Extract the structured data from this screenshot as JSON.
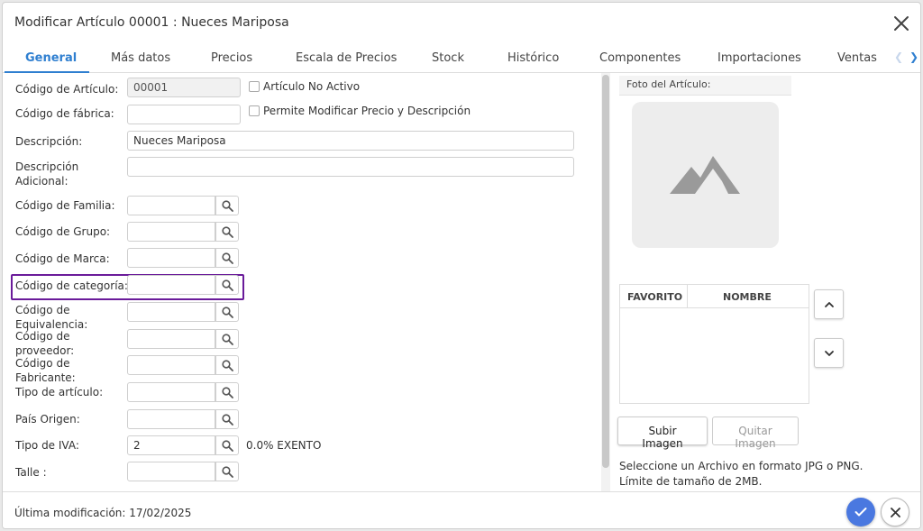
{
  "dialog": {
    "title": "Modificar Artículo 00001 : Nueces Mariposa",
    "close_icon": "close-icon"
  },
  "tabs": [
    {
      "label": "General",
      "active": true
    },
    {
      "label": "Más datos"
    },
    {
      "label": "Precios"
    },
    {
      "label": "Escala de Precios"
    },
    {
      "label": "Stock"
    },
    {
      "label": "Histórico"
    },
    {
      "label": "Componentes"
    },
    {
      "label": "Importaciones"
    },
    {
      "label": "Ventas"
    }
  ],
  "form": {
    "codigo_articulo": {
      "label": "Código de Artículo:",
      "value": "00001"
    },
    "articulo_no_activo": {
      "label": "Artículo No Activo",
      "checked": false
    },
    "codigo_fabrica": {
      "label": "Código de fábrica:",
      "value": ""
    },
    "permite_modificar": {
      "label": "Permite Modificar Precio y Descripción",
      "checked": false
    },
    "descripcion": {
      "label": "Descripción:",
      "value": "Nueces Mariposa"
    },
    "descripcion_adicional": {
      "label_line1": "Descripción",
      "label_line2": "Adicional:",
      "value": ""
    },
    "codigo_familia": {
      "label": "Código de Familia:",
      "value": ""
    },
    "codigo_grupo": {
      "label": "Código de Grupo:",
      "value": ""
    },
    "codigo_marca": {
      "label": "Código de Marca:",
      "value": ""
    },
    "codigo_categoria": {
      "label": "Código de categoría:",
      "value": ""
    },
    "codigo_equivalencia": {
      "label_line1": "Código de",
      "label_line2": "Equivalencia:",
      "value": ""
    },
    "codigo_proveedor": {
      "label_line1": "Código de",
      "label_line2": "proveedor:",
      "value": ""
    },
    "codigo_fabricante": {
      "label_line1": "Código de",
      "label_line2": "Fabricante:",
      "value": ""
    },
    "tipo_articulo": {
      "label": "Tipo de artículo:",
      "value": ""
    },
    "pais_origen": {
      "label": "País Origen:",
      "value": ""
    },
    "tipo_iva": {
      "label": "Tipo de IVA:",
      "value": "2",
      "description": "0.0% EXENTO"
    },
    "talle": {
      "label": "Talle :",
      "value": ""
    }
  },
  "image_panel": {
    "title": "Foto del Artículo:",
    "placeholder_icon": "image-placeholder-icon",
    "grid_columns": [
      "FAVORITO",
      "NOMBRE"
    ],
    "upload_label": "Subir Imagen",
    "remove_label": "Quitar Imagen",
    "hint_line1": "Seleccione un Archivo en formato JPG o PNG.",
    "hint_line2": "Límite de tamaño de 2MB."
  },
  "footer": {
    "last_modified": "Última modificación: 17/02/2025"
  },
  "colors": {
    "accent": "#2f7fd0",
    "confirm": "#4a78e0",
    "highlight": "#6a1b9a"
  }
}
